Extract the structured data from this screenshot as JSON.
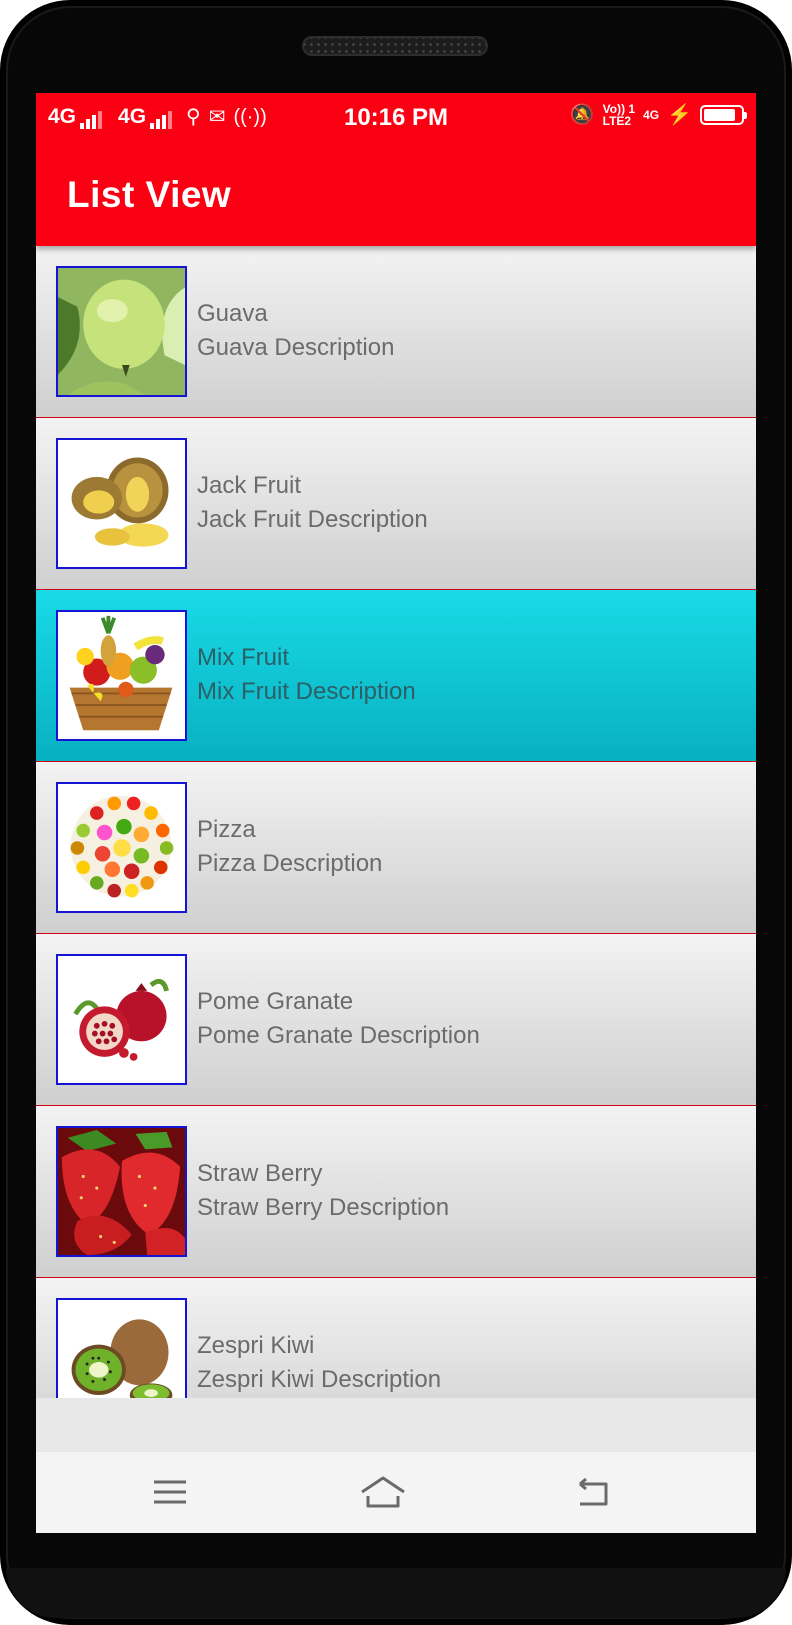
{
  "status_bar": {
    "sim1": "4G",
    "sim2": "4G",
    "time": "10:16 PM",
    "volte_label": "Vo)) 1",
    "lte_label": "LTE2",
    "net_label": "4G",
    "battery_level": 0.85
  },
  "app_bar": {
    "title": "List View"
  },
  "list": {
    "selected_index": 2,
    "items": [
      {
        "title": "Guava",
        "description": "Guava Description",
        "icon": "guava-image"
      },
      {
        "title": "Jack Fruit",
        "description": "Jack Fruit Description",
        "icon": "jackfruit-image"
      },
      {
        "title": "Mix Fruit",
        "description": "Mix Fruit Description",
        "icon": "fruit-basket-image"
      },
      {
        "title": "Pizza",
        "description": "Pizza Description",
        "icon": "fruit-circle-image"
      },
      {
        "title": "Pome Granate",
        "description": "Pome Granate Description",
        "icon": "pomegranate-image"
      },
      {
        "title": "Straw Berry",
        "description": "Straw Berry Description",
        "icon": "strawberry-image"
      },
      {
        "title": "Zespri Kiwi",
        "description": "Zespri Kiwi Description",
        "icon": "kiwi-image"
      }
    ]
  },
  "nav_bar": {
    "buttons": [
      "menu-icon",
      "home-icon",
      "back-icon"
    ]
  },
  "colors": {
    "primary": "#fb0013",
    "selected_row": "#19dae6",
    "thumb_border": "#1414d2",
    "row_text": "#6b6b6b"
  }
}
